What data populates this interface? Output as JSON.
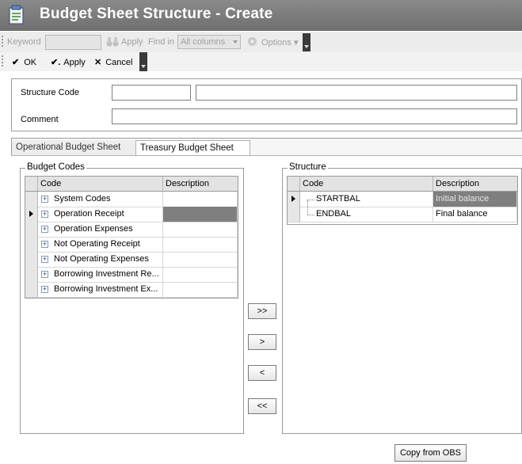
{
  "window": {
    "title": "Budget Sheet Structure - Create",
    "icon": "form-icon"
  },
  "toolbar": {
    "keyword_label": "Keyword",
    "keyword_value": "",
    "apply_label": "Apply",
    "find_in_label": "Find in",
    "find_in_value": "All columns",
    "options_label": "Options"
  },
  "actions": {
    "ok_label": "OK",
    "apply_label": "Apply",
    "cancel_label": "Cancel"
  },
  "header": {
    "structure_code_label": "Structure Code",
    "structure_code_value": "",
    "structure_desc_value": "",
    "comment_label": "Comment",
    "comment_value": ""
  },
  "tabs": [
    {
      "label": "Operational Budget Sheet",
      "active": false
    },
    {
      "label": "Treasury Budget Sheet",
      "active": true
    }
  ],
  "budget_codes": {
    "title": "Budget Codes",
    "columns": [
      "Code",
      "Description"
    ],
    "rows": [
      {
        "code": "System Codes",
        "description": ""
      },
      {
        "code": "Operation Receipt",
        "description": ""
      },
      {
        "code": "Operation Expenses",
        "description": ""
      },
      {
        "code": "Not Operating Receipt",
        "description": ""
      },
      {
        "code": "Not Operating Expenses",
        "description": ""
      },
      {
        "code": "Borrowing Investment Re...",
        "description": ""
      },
      {
        "code": "Borrowing Investment Ex...",
        "description": ""
      }
    ]
  },
  "structure": {
    "title": "Structure",
    "columns": [
      "Code",
      "Description"
    ],
    "rows": [
      {
        "code": "STARTBAL",
        "description": "Initial balance"
      },
      {
        "code": "ENDBAL",
        "description": "Final balance"
      }
    ]
  },
  "move_buttons": {
    "add_all": ">>",
    "add_one": ">",
    "remove_one": "<",
    "remove_all": "<<"
  },
  "copy_button_label": "Copy from OBS"
}
